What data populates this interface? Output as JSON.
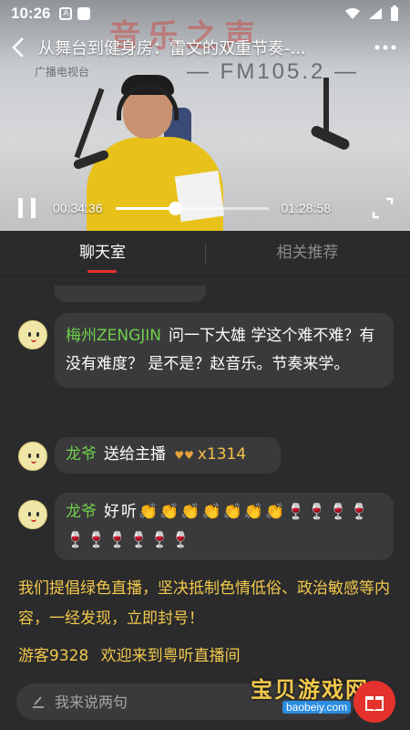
{
  "status": {
    "time": "10:26"
  },
  "video": {
    "title": "从舞台到健身房：雷文的双重节奏-...",
    "current_time": "00:34:36",
    "total_time": "01:28:58",
    "progress": 0.389
  },
  "tabs": [
    {
      "label": "聊天室",
      "active": true
    },
    {
      "label": "相关推荐",
      "active": false
    }
  ],
  "chat": {
    "messages": [
      {
        "user": "梅州ZENGJIN",
        "text": "问一下大雄 学这个难不难？有没有难度？ 是不是？赵音乐。节奏来学。"
      },
      {
        "user": "龙爷",
        "text": "送给主播",
        "gift_count": "x1314"
      },
      {
        "user": "龙爷",
        "text": "好听👏👏👏👏👏👏👏🍷🍷🍷🍷🍷🍷🍷🍷🍷🍷"
      }
    ],
    "notice": "我们提倡绿色直播，坚决抵制色情低俗、政治敏感等内容，一经发现，立即封号！",
    "welcome_user": "游客9328",
    "welcome_text": "欢迎来到粤听直播间"
  },
  "input": {
    "placeholder": "我来说两句"
  },
  "colors": {
    "accent": "#e5322c",
    "username": "#6fcf4a",
    "notice": "#f2c94c"
  },
  "watermark": {
    "text": "宝贝游戏网",
    "url": "baobeiy.com"
  }
}
